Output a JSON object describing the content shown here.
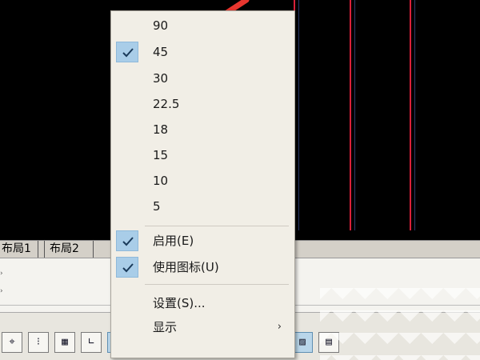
{
  "layout_tabs": [
    "布局1",
    "布局2"
  ],
  "angle_menu": {
    "angles": [
      {
        "label": "90",
        "checked": false
      },
      {
        "label": "45",
        "checked": true
      },
      {
        "label": "30",
        "checked": false
      },
      {
        "label": "22.5",
        "checked": false
      },
      {
        "label": "18",
        "checked": false
      },
      {
        "label": "15",
        "checked": false
      },
      {
        "label": "10",
        "checked": false
      },
      {
        "label": "5",
        "checked": false
      }
    ],
    "options": [
      {
        "label": "启用(E)",
        "checked": true
      },
      {
        "label": "使用图标(U)",
        "checked": true
      }
    ],
    "settings_label": "设置(S)...",
    "display_label": "显示",
    "display_arrow": "›"
  },
  "status_bar": {
    "buttons": [
      {
        "icon": "snap-icon",
        "glyph": "⌖",
        "on": false
      },
      {
        "icon": "grid-dots-icon",
        "glyph": "⁝",
        "on": false
      },
      {
        "icon": "grid-icon",
        "glyph": "▦",
        "on": false
      },
      {
        "icon": "ortho-icon",
        "glyph": "∟",
        "on": false
      },
      {
        "icon": "polar-icon",
        "glyph": "◔",
        "on": true
      },
      {
        "icon": "osnap-icon",
        "glyph": "□",
        "on": false
      },
      {
        "icon": "3d-osnap-icon",
        "glyph": "⧉",
        "on": false
      },
      {
        "icon": "otrack-icon",
        "glyph": "∠",
        "on": false
      },
      {
        "icon": "ducs-icon",
        "glyph": "⊿",
        "on": false
      },
      {
        "icon": "dyn-icon",
        "glyph": "⊹",
        "on": false
      },
      {
        "icon": "lineweight-icon",
        "glyph": "┿",
        "on": false
      },
      {
        "icon": "transparency-icon",
        "glyph": "▨",
        "on": true
      },
      {
        "icon": "quick-properties-icon",
        "glyph": "▤",
        "on": false
      }
    ]
  },
  "colors": {
    "line_color": "#d8203a",
    "menu_bg": "#f1eee6",
    "check_bg": "#a9cde8",
    "arrow_color": "#e8362f"
  }
}
